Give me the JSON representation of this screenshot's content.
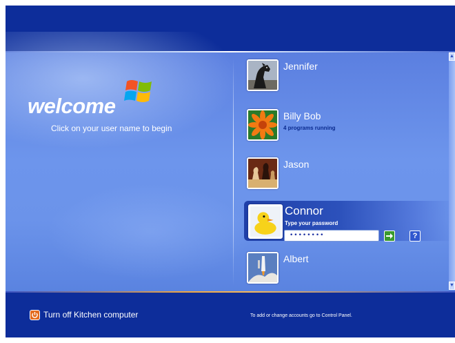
{
  "welcome": {
    "title": "welcome",
    "subtitle": "Click on your user name to begin"
  },
  "users": [
    {
      "name": "Jennifer",
      "status": "",
      "avatar": "horse-icon"
    },
    {
      "name": "Billy Bob",
      "status": "4 programs running",
      "avatar": "flower-icon"
    },
    {
      "name": "Jason",
      "status": "",
      "avatar": "chess-icon"
    },
    {
      "name": "Connor",
      "status": "",
      "avatar": "rubber-duck-icon"
    },
    {
      "name": "Albert",
      "status": "",
      "avatar": "rocket-launch-icon"
    }
  ],
  "login": {
    "prompt": "Type your password",
    "password_value": "••••••••",
    "go_icon": "arrow-right-icon",
    "help_icon": "question-mark-icon",
    "help_label": "?"
  },
  "footer": {
    "turn_off_label": "Turn off Kitchen computer",
    "note": "To add or change accounts go to Control Panel."
  },
  "colors": {
    "topbar": "#0d2d9a",
    "background": "#6b93ea",
    "selected": "#2c51bb",
    "go_button": "#3a9a2e",
    "power_button": "#e36a1d"
  }
}
